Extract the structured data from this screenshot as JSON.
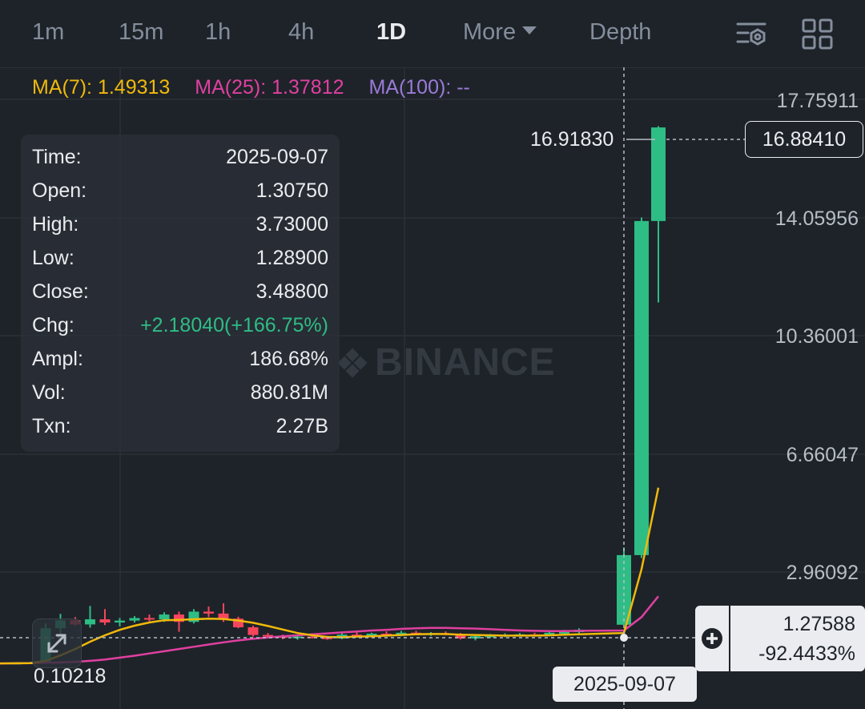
{
  "toolbar": {
    "timeframes": [
      "1m",
      "15m",
      "1h",
      "4h",
      "1D"
    ],
    "active": "1D",
    "more_label": "More",
    "depth_label": "Depth",
    "icons": [
      "chart-settings-icon",
      "layout-grid-icon"
    ]
  },
  "indicators": {
    "ma7": "MA(7): 1.49313",
    "ma25": "MA(25): 1.37812",
    "ma100": "MA(100): --"
  },
  "colors": {
    "up": "#2ebd85",
    "down": "#f6465d",
    "ma7": "#f0b90b",
    "ma25": "#e040a0",
    "ma100": "#9b7ad8",
    "background": "#1e2329"
  },
  "info": {
    "rows": [
      {
        "label": "Time:",
        "value": "2025-09-07"
      },
      {
        "label": "Open:",
        "value": "1.30750"
      },
      {
        "label": "High:",
        "value": "3.73000"
      },
      {
        "label": "Low:",
        "value": "1.28900"
      },
      {
        "label": "Close:",
        "value": "3.48800"
      },
      {
        "label": "Chg:",
        "value": "+2.18040(+166.75%)"
      },
      {
        "label": "Ampl:",
        "value": "186.68%"
      },
      {
        "label": "Vol:",
        "value": "880.81M"
      },
      {
        "label": "Txn:",
        "value": "2.27B"
      }
    ]
  },
  "price_axis": {
    "labels": [
      "17.75911",
      "14.05956",
      "10.36001",
      "6.66047",
      "2.96092"
    ]
  },
  "last_price": "16.88410",
  "high_marker": "16.91830",
  "low_marker": "0.10218",
  "crosshair": {
    "price": "1.27588",
    "percent": "-92.4433%",
    "date": "2025-09-07"
  },
  "watermark": "BINANCE",
  "chart_data": {
    "type": "candlestick",
    "ylim": [
      0,
      19
    ],
    "candles": [
      {
        "o": 0.1,
        "h": 0.14,
        "l": 0.09,
        "c": 0.12
      },
      {
        "o": 0.12,
        "h": 0.15,
        "l": 0.1,
        "c": 0.13
      },
      {
        "o": 0.13,
        "h": 1.35,
        "l": 0.12,
        "c": 1.2
      },
      {
        "o": 1.2,
        "h": 1.65,
        "l": 0.98,
        "c": 1.45
      },
      {
        "o": 1.45,
        "h": 1.55,
        "l": 1.28,
        "c": 1.32
      },
      {
        "o": 1.32,
        "h": 1.9,
        "l": 1.22,
        "c": 1.48
      },
      {
        "o": 1.48,
        "h": 1.8,
        "l": 1.3,
        "c": 1.38
      },
      {
        "o": 1.38,
        "h": 1.52,
        "l": 1.26,
        "c": 1.44
      },
      {
        "o": 1.44,
        "h": 1.58,
        "l": 1.38,
        "c": 1.52
      },
      {
        "o": 1.52,
        "h": 1.63,
        "l": 1.42,
        "c": 1.48
      },
      {
        "o": 1.48,
        "h": 1.7,
        "l": 1.4,
        "c": 1.63
      },
      {
        "o": 1.63,
        "h": 1.72,
        "l": 1.09,
        "c": 1.4
      },
      {
        "o": 1.4,
        "h": 1.8,
        "l": 1.35,
        "c": 1.72
      },
      {
        "o": 1.72,
        "h": 1.88,
        "l": 1.55,
        "c": 1.66
      },
      {
        "o": 1.66,
        "h": 1.98,
        "l": 1.4,
        "c": 1.5
      },
      {
        "o": 1.5,
        "h": 1.56,
        "l": 1.2,
        "c": 1.23
      },
      {
        "o": 1.23,
        "h": 1.28,
        "l": 0.94,
        "c": 0.99
      },
      {
        "o": 0.99,
        "h": 1.05,
        "l": 0.88,
        "c": 0.96
      },
      {
        "o": 0.96,
        "h": 1.0,
        "l": 0.86,
        "c": 0.9
      },
      {
        "o": 0.9,
        "h": 0.98,
        "l": 0.84,
        "c": 0.94
      },
      {
        "o": 0.94,
        "h": 1.02,
        "l": 0.88,
        "c": 0.91
      },
      {
        "o": 0.91,
        "h": 0.96,
        "l": 0.84,
        "c": 0.88
      },
      {
        "o": 0.88,
        "h": 1.05,
        "l": 0.86,
        "c": 1.0
      },
      {
        "o": 1.0,
        "h": 1.08,
        "l": 0.92,
        "c": 0.97
      },
      {
        "o": 0.97,
        "h": 1.06,
        "l": 0.92,
        "c": 1.03
      },
      {
        "o": 1.03,
        "h": 1.1,
        "l": 0.96,
        "c": 1.0
      },
      {
        "o": 1.0,
        "h": 1.12,
        "l": 0.95,
        "c": 1.06
      },
      {
        "o": 1.06,
        "h": 1.12,
        "l": 0.99,
        "c": 1.02
      },
      {
        "o": 1.02,
        "h": 1.08,
        "l": 0.96,
        "c": 1.04
      },
      {
        "o": 1.04,
        "h": 1.1,
        "l": 0.98,
        "c": 1.01
      },
      {
        "o": 1.01,
        "h": 1.05,
        "l": 0.85,
        "c": 0.88
      },
      {
        "o": 0.88,
        "h": 0.98,
        "l": 0.82,
        "c": 0.95
      },
      {
        "o": 0.95,
        "h": 1.02,
        "l": 0.9,
        "c": 0.97
      },
      {
        "o": 0.97,
        "h": 1.04,
        "l": 0.92,
        "c": 0.99
      },
      {
        "o": 0.99,
        "h": 1.05,
        "l": 0.94,
        "c": 1.01
      },
      {
        "o": 1.01,
        "h": 1.06,
        "l": 0.96,
        "c": 1.0
      },
      {
        "o": 1.0,
        "h": 1.1,
        "l": 0.97,
        "c": 1.06
      },
      {
        "o": 1.06,
        "h": 1.15,
        "l": 1.01,
        "c": 1.08
      },
      {
        "o": 1.08,
        "h": 1.2,
        "l": 1.03,
        "c": 1.15
      },
      {
        "o": 1.31,
        "h": 3.73,
        "l": 1.29,
        "c": 3.49
      },
      {
        "o": 3.49,
        "h": 14.06,
        "l": 3.4,
        "c": 13.95
      },
      {
        "o": 13.95,
        "h": 16.92,
        "l": 11.4,
        "c": 16.88
      }
    ],
    "ma7": [
      0.1,
      0.11,
      0.18,
      0.35,
      0.55,
      0.78,
      0.98,
      1.15,
      1.28,
      1.38,
      1.45,
      1.46,
      1.48,
      1.5,
      1.49,
      1.44,
      1.37,
      1.27,
      1.16,
      1.05,
      0.98,
      0.93,
      0.92,
      0.94,
      0.95,
      0.97,
      0.99,
      1.01,
      1.02,
      1.02,
      1.0,
      0.99,
      0.98,
      0.97,
      0.97,
      0.97,
      0.98,
      1.0,
      1.01,
      1.05,
      3.05,
      5.6
    ],
    "ma25": [
      0.1,
      0.11,
      0.12,
      0.13,
      0.15,
      0.18,
      0.22,
      0.28,
      0.34,
      0.41,
      0.48,
      0.55,
      0.62,
      0.69,
      0.76,
      0.82,
      0.87,
      0.91,
      0.95,
      0.98,
      1.01,
      1.04,
      1.07,
      1.1,
      1.13,
      1.15,
      1.18,
      1.2,
      1.21,
      1.21,
      1.2,
      1.19,
      1.17,
      1.15,
      1.13,
      1.12,
      1.11,
      1.11,
      1.12,
      1.13,
      1.55,
      2.2
    ]
  }
}
